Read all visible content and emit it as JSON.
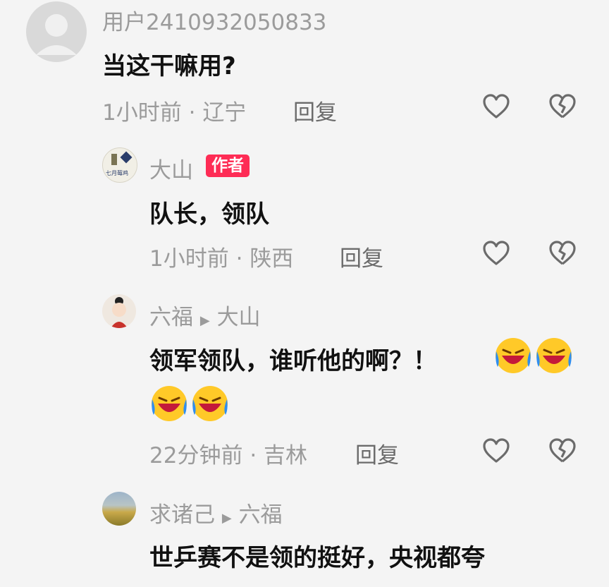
{
  "comments": [
    {
      "username": "用户2410932050833",
      "text": "当这干嘛用?",
      "time": "1小时前",
      "location": "辽宁",
      "reply": "回复"
    },
    {
      "username": "大山",
      "badge": "作者",
      "text": "队长，领队",
      "time": "1小时前",
      "location": "陕西",
      "reply": "回复",
      "avatar_text": "七月莓鸡"
    },
    {
      "username": "六福",
      "reply_to": "大山",
      "text": "领军领队，谁听他的啊？！",
      "time": "22分钟前",
      "location": "吉林",
      "reply": "回复"
    },
    {
      "username": "求诸己",
      "reply_to": "六福",
      "text": "世乒赛不是领的挺好，央视都夸"
    }
  ],
  "separator": "·",
  "icons": {
    "like": "heart-outline-icon",
    "dislike": "broken-heart-icon",
    "emoji": "laughing-crying-emoji",
    "arrow": "play-arrow-icon"
  },
  "colors": {
    "badge": "#fe2c55",
    "meta_text": "#9b9b9b",
    "background": "#f4f4f4"
  }
}
